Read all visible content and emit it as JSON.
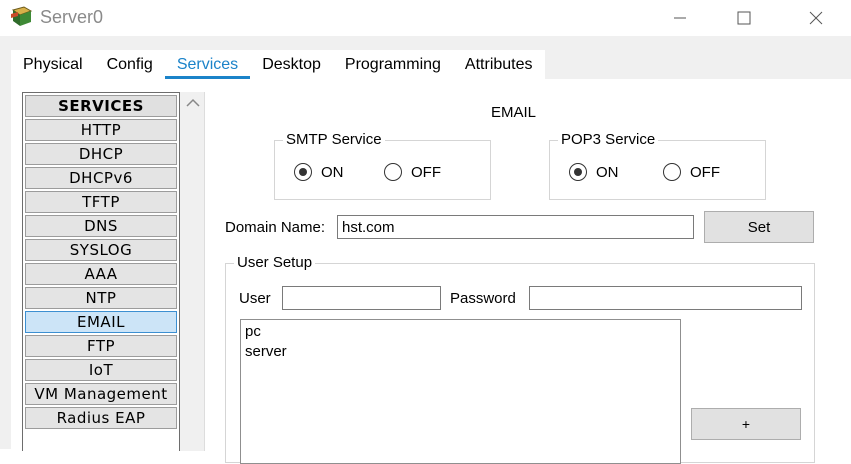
{
  "window": {
    "title": "Server0",
    "minimize_glyph": "—",
    "maximize_glyph": "☐",
    "close_glyph": "✕"
  },
  "tabs": [
    {
      "label": "Physical",
      "active": false
    },
    {
      "label": "Config",
      "active": false
    },
    {
      "label": "Services",
      "active": true
    },
    {
      "label": "Desktop",
      "active": false
    },
    {
      "label": "Programming",
      "active": false
    },
    {
      "label": "Attributes",
      "active": false
    }
  ],
  "services": {
    "header": "SERVICES",
    "items": [
      "HTTP",
      "DHCP",
      "DHCPv6",
      "TFTP",
      "DNS",
      "SYSLOG",
      "AAA",
      "NTP",
      "EMAIL",
      "FTP",
      "IoT",
      "VM Management",
      "Radius EAP"
    ],
    "selected": "EMAIL"
  },
  "email": {
    "title": "EMAIL",
    "smtp": {
      "legend": "SMTP Service",
      "on_label": "ON",
      "off_label": "OFF",
      "state": "on"
    },
    "pop3": {
      "legend": "POP3 Service",
      "on_label": "ON",
      "off_label": "OFF",
      "state": "on"
    },
    "domain": {
      "label": "Domain Name:",
      "value": "hst.com",
      "set_label": "Set"
    },
    "user_setup": {
      "legend": "User Setup",
      "user_label": "User",
      "user_value": "",
      "password_label": "Password",
      "password_value": "",
      "users": [
        "pc",
        "server"
      ],
      "add_label": "+"
    }
  },
  "colors": {
    "accent": "#1b83c9",
    "selected_bg": "#cce4f7"
  }
}
